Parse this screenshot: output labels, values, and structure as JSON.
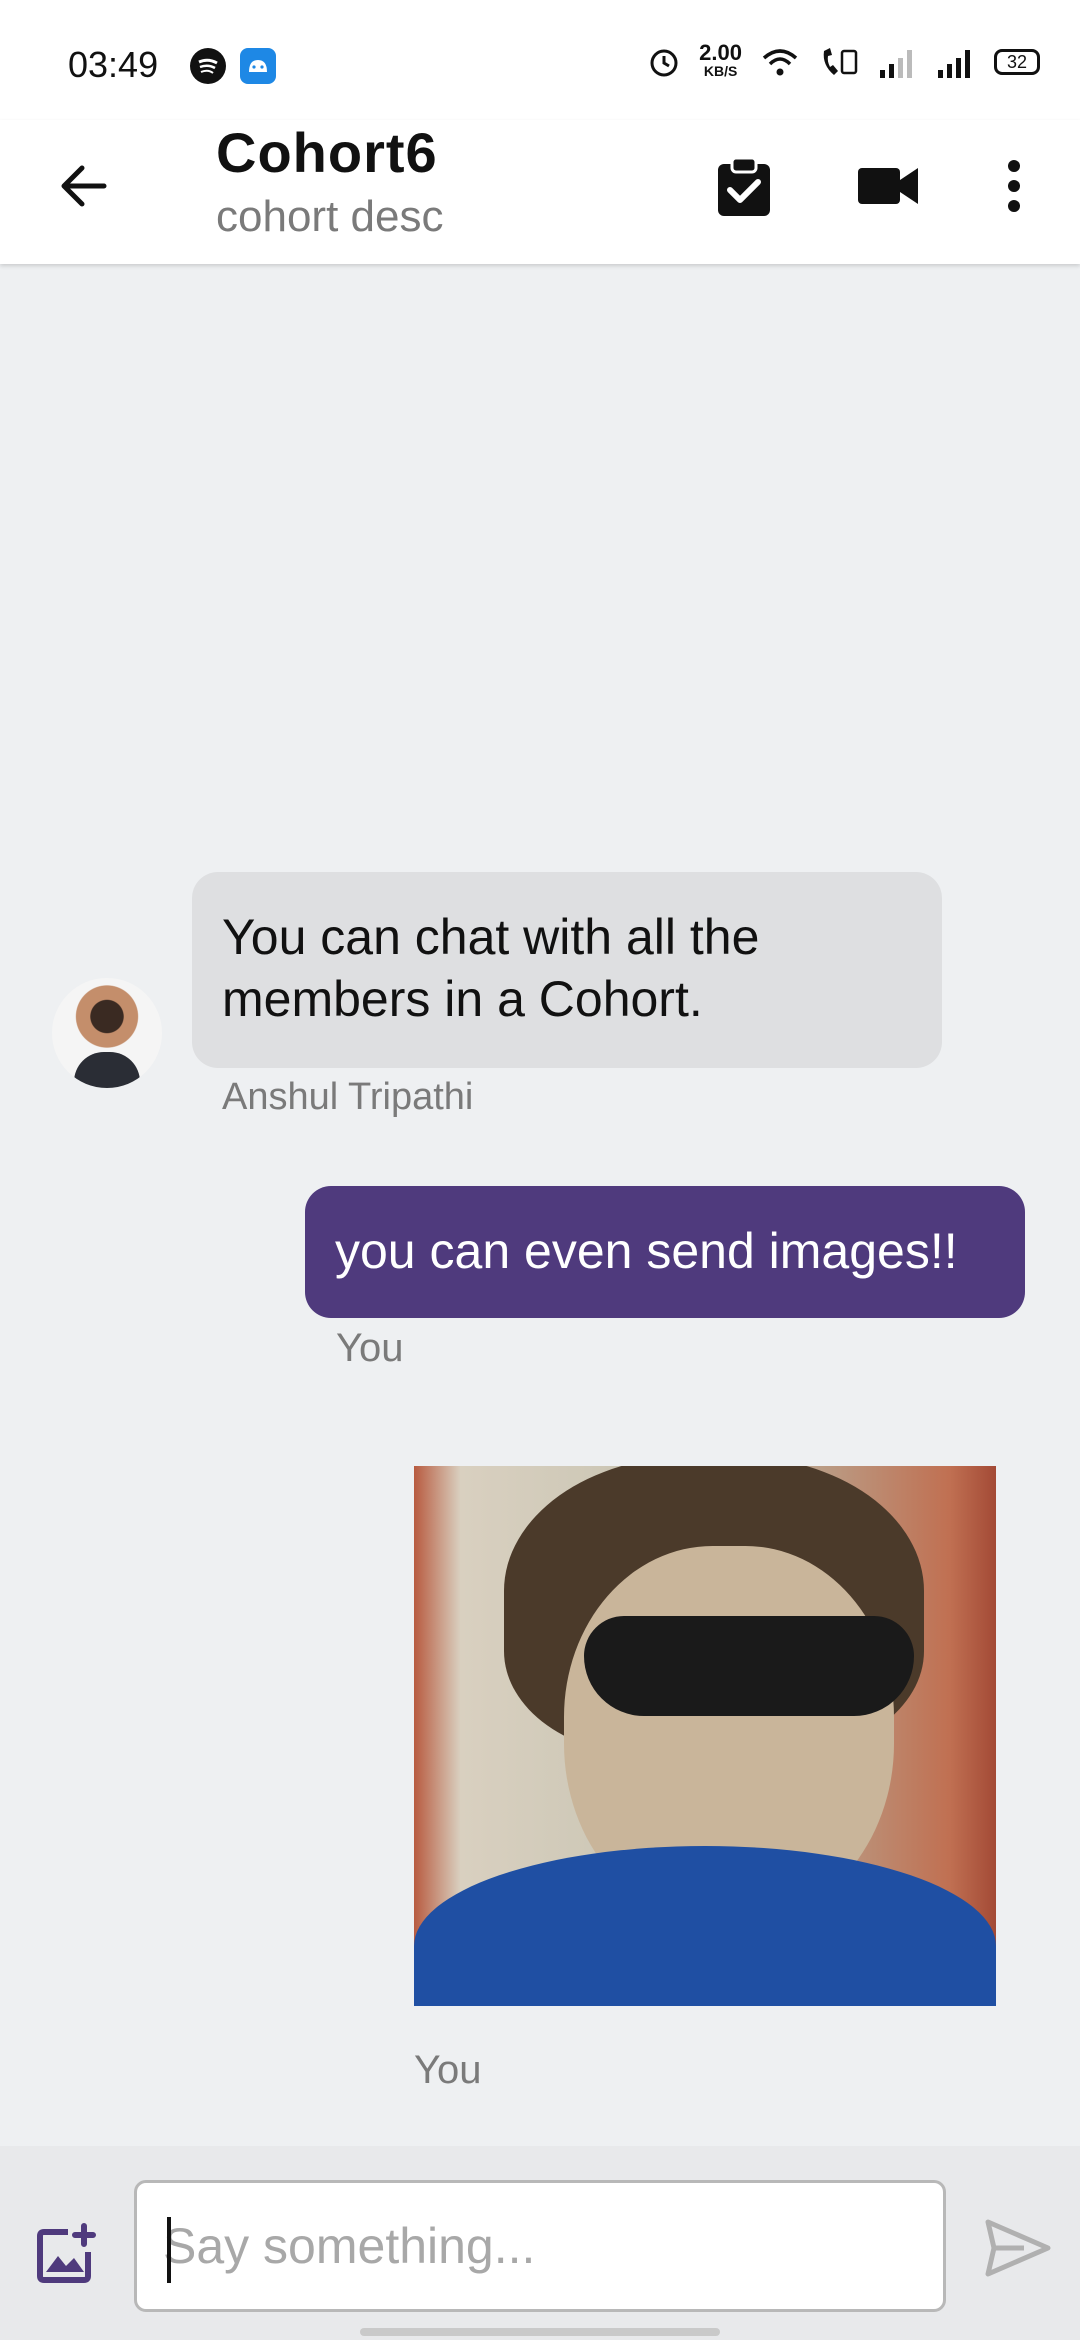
{
  "status_bar": {
    "time": "03:49",
    "net_speed": "2.00",
    "net_unit": "KB/S",
    "battery": "32"
  },
  "header": {
    "title": "Cohort6",
    "subtitle": "cohort desc"
  },
  "messages": [
    {
      "text": "You can chat with all the members in a Cohort.",
      "sender": "Anshul Tripathi"
    },
    {
      "text": "you can even send images!!",
      "sender": "You"
    },
    {
      "type": "image",
      "sender": "You"
    }
  ],
  "composer": {
    "placeholder": "Say something..."
  },
  "colors": {
    "outgoing_bubble": "#4f3a7d",
    "incoming_bubble": "#dedfe1",
    "background": "#eef0f2"
  },
  "icons": [
    "back-arrow-icon",
    "task-check-icon",
    "video-call-icon",
    "more-vert-icon",
    "add-image-icon",
    "send-icon"
  ]
}
